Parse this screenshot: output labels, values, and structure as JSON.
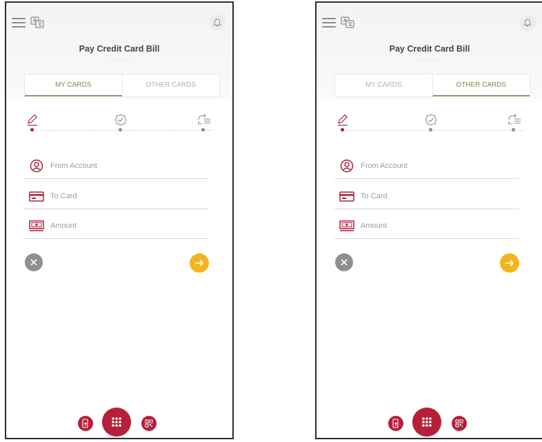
{
  "colors": {
    "accent": "#a6213a",
    "brand_red": "#b4203a",
    "next_button": "#f4b41f",
    "cancel_button": "#8f8f8f",
    "active_tab": "#7d8c52"
  },
  "screens": [
    {
      "header": {
        "menu_icon": "hamburger-icon",
        "language_icon": "language-toggle-icon",
        "notification_icon": "bell-icon",
        "title": "Pay Credit Card Bill",
        "title_dots": "............"
      },
      "tabs": [
        {
          "label": "MY CARDS",
          "active": true
        },
        {
          "label": "OTHER CARDS",
          "active": false
        }
      ],
      "steps": [
        {
          "icon": "pencil-icon",
          "active": true
        },
        {
          "icon": "verify-badge-icon",
          "active": false
        },
        {
          "icon": "send-list-icon",
          "active": false
        }
      ],
      "form": {
        "from_account_placeholder": "From Account",
        "to_card_placeholder": "To Card",
        "amount_placeholder": "Amount"
      },
      "actions": {
        "cancel_icon": "close-icon",
        "next_icon": "arrow-right-icon"
      },
      "bottom_nav": {
        "left_icon": "phone-pay-icon",
        "center_icon": "grid-menu-icon",
        "right_icon": "qr-code-icon"
      }
    },
    {
      "header": {
        "menu_icon": "hamburger-icon",
        "language_icon": "language-toggle-icon",
        "notification_icon": "bell-icon",
        "title": "Pay Credit Card Bill",
        "title_dots": "............"
      },
      "tabs": [
        {
          "label": "MY CARDS",
          "active": false
        },
        {
          "label": "OTHER CARDS",
          "active": true
        }
      ],
      "steps": [
        {
          "icon": "pencil-icon",
          "active": true
        },
        {
          "icon": "verify-badge-icon",
          "active": false
        },
        {
          "icon": "send-list-icon",
          "active": false
        }
      ],
      "form": {
        "from_account_placeholder": "From Account",
        "to_card_placeholder": "To Card",
        "amount_placeholder": "Amount"
      },
      "actions": {
        "cancel_icon": "close-icon",
        "next_icon": "arrow-right-icon"
      },
      "bottom_nav": {
        "left_icon": "phone-pay-icon",
        "center_icon": "grid-menu-icon",
        "right_icon": "qr-code-icon"
      }
    }
  ]
}
